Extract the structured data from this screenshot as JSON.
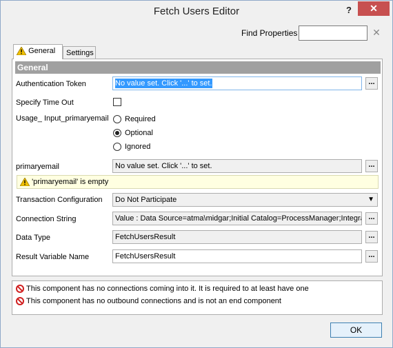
{
  "window": {
    "title": "Fetch Users Editor",
    "help_label": "?",
    "close_label": "✕"
  },
  "find": {
    "label": "Find Properties",
    "value": "",
    "clear_label": "✕"
  },
  "tabs": [
    {
      "label": "General",
      "active": true,
      "icon": "warning-icon"
    },
    {
      "label": "Settings",
      "active": false
    }
  ],
  "section": {
    "title": "General"
  },
  "fields": {
    "auth_token": {
      "label": "Authentication Token",
      "value": "No value set. Click '...' to set.",
      "button": "..."
    },
    "timeout": {
      "label": "Specify Time Out",
      "checked": false
    },
    "usage": {
      "label": "Usage_ Input_primaryemail",
      "options": [
        "Required",
        "Optional",
        "Ignored"
      ],
      "selected": "Optional"
    },
    "primaryemail": {
      "label": "primaryemail",
      "value": "No value set. Click '...' to set.",
      "button": "..."
    },
    "warning": "'primaryemail' is empty",
    "transaction": {
      "label": "Transaction Configuration",
      "value": "Do Not Participate"
    },
    "connection": {
      "label": "Connection String",
      "value": "Value : Data Source=atma\\midgar;Initial Catalog=ProcessManager;Integra",
      "button": "..."
    },
    "datatype": {
      "label": "Data Type",
      "value": "FetchUsersResult",
      "button": "..."
    },
    "result_var": {
      "label": "Result Variable Name",
      "value": "FetchUsersResult",
      "button": "..."
    }
  },
  "errors": [
    "This component has no connections coming into it.  It is required to at least have one",
    "This component has no outbound connections and is not an end component"
  ],
  "ok_label": "OK",
  "colors": {
    "error": "#d02020",
    "warning": "#f0c000",
    "header_gray": "#a0a0a0",
    "selection": "#3399ff"
  }
}
